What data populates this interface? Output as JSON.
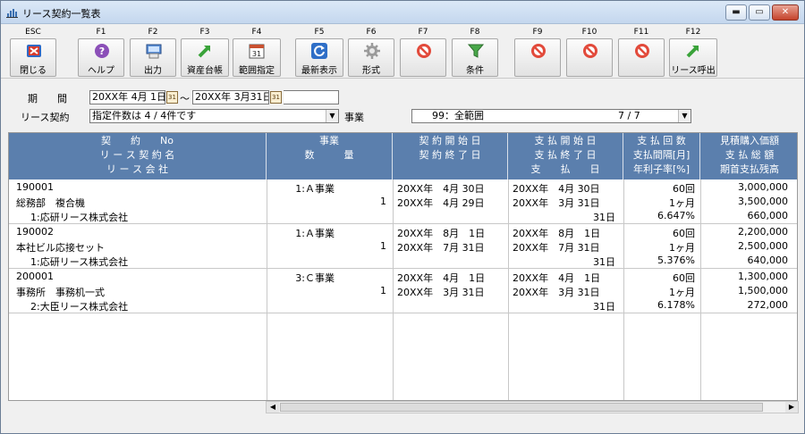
{
  "window": {
    "title": "リース契約一覧表",
    "minimize": "▬",
    "maximize": "▭",
    "close": "✕"
  },
  "toolbar": [
    {
      "fkey": "ESC",
      "label": "閉じる",
      "icon": "close-icon"
    },
    {
      "fkey": "F1",
      "label": "ヘルプ",
      "icon": "help-icon"
    },
    {
      "fkey": "F2",
      "label": "出力",
      "icon": "output-icon"
    },
    {
      "fkey": "F3",
      "label": "資産台帳",
      "icon": "arrow-icon"
    },
    {
      "fkey": "F4",
      "label": "範囲指定",
      "icon": "calendar-icon"
    },
    {
      "fkey": "F5",
      "label": "最新表示",
      "icon": "refresh-icon"
    },
    {
      "fkey": "F6",
      "label": "形式",
      "icon": "gear-icon"
    },
    {
      "fkey": "F7",
      "label": "",
      "icon": "disabled-icon"
    },
    {
      "fkey": "F8",
      "label": "条件",
      "icon": "filter-icon"
    },
    {
      "fkey": "F9",
      "label": "",
      "icon": "disabled-icon"
    },
    {
      "fkey": "F10",
      "label": "",
      "icon": "disabled-icon"
    },
    {
      "fkey": "F11",
      "label": "",
      "icon": "disabled-icon"
    },
    {
      "fkey": "F12",
      "label": "リース呼出",
      "icon": "arrow-icon"
    }
  ],
  "filters": {
    "period_label": "期　　間",
    "period_from": "20XX年 4月 1日",
    "period_tilde": "～",
    "period_to": "20XX年 3月31日",
    "lease_label": "リース契約",
    "lease_value": "指定件数は 4 / 4件です",
    "business_label": "事業",
    "business_value": "99：全範囲",
    "business_count": "7 / 7",
    "calendar_glyph": "31"
  },
  "headers": {
    "col1": [
      "契　　約　　No",
      "リ ー ス 契 約 名",
      "リ ー ス 会 社"
    ],
    "col2": [
      "事業",
      "数　　　量"
    ],
    "col3": [
      "契 約 開 始 日",
      "契 約 終 了 日"
    ],
    "col4": [
      "支 払 開 始 日",
      "支 払 終 了 日",
      "支　　払　　日"
    ],
    "col5": [
      "支 払 回 数",
      "支払間隔[月]",
      "年利子率[%]"
    ],
    "col6": [
      "見積購入価額",
      "支 払 総 額",
      "期首支払残高"
    ]
  },
  "rows": [
    {
      "no": "190001",
      "name": "総務部　複合機",
      "company": "1:応研リース株式会社",
      "business": "1:Ａ事業",
      "qty": "1",
      "start": "20XX年　4月 30日",
      "end": "20XX年　4月 29日",
      "pay_start": "20XX年　4月 30日",
      "pay_end": "20XX年　3月 31日",
      "pay_day": "31日",
      "count": "60回",
      "interval": "1ヶ月",
      "rate": "6.647%",
      "v1": "3,000,000",
      "v2": "3,500,000",
      "v3": "660,000"
    },
    {
      "no": "190002",
      "name": "本社ビル応接セット",
      "company": "1:応研リース株式会社",
      "business": "1:Ａ事業",
      "qty": "1",
      "start": "20XX年　8月　1日",
      "end": "20XX年　7月 31日",
      "pay_start": "20XX年　8月　1日",
      "pay_end": "20XX年　7月 31日",
      "pay_day": "31日",
      "count": "60回",
      "interval": "1ヶ月",
      "rate": "5.376%",
      "v1": "2,200,000",
      "v2": "2,500,000",
      "v3": "640,000"
    },
    {
      "no": "200001",
      "name": "事務所　事務机一式",
      "company": "2:大臣リース株式会社",
      "business": "3:Ｃ事業",
      "qty": "1",
      "start": "20XX年　4月　1日",
      "end": "20XX年　3月 31日",
      "pay_start": "20XX年　4月　1日",
      "pay_end": "20XX年　3月 31日",
      "pay_day": "31日",
      "count": "60回",
      "interval": "1ヶ月",
      "rate": "6.178%",
      "v1": "1,300,000",
      "v2": "1,500,000",
      "v3": "272,000"
    }
  ],
  "scrollbar": {
    "left": "◀",
    "right": "▶"
  }
}
